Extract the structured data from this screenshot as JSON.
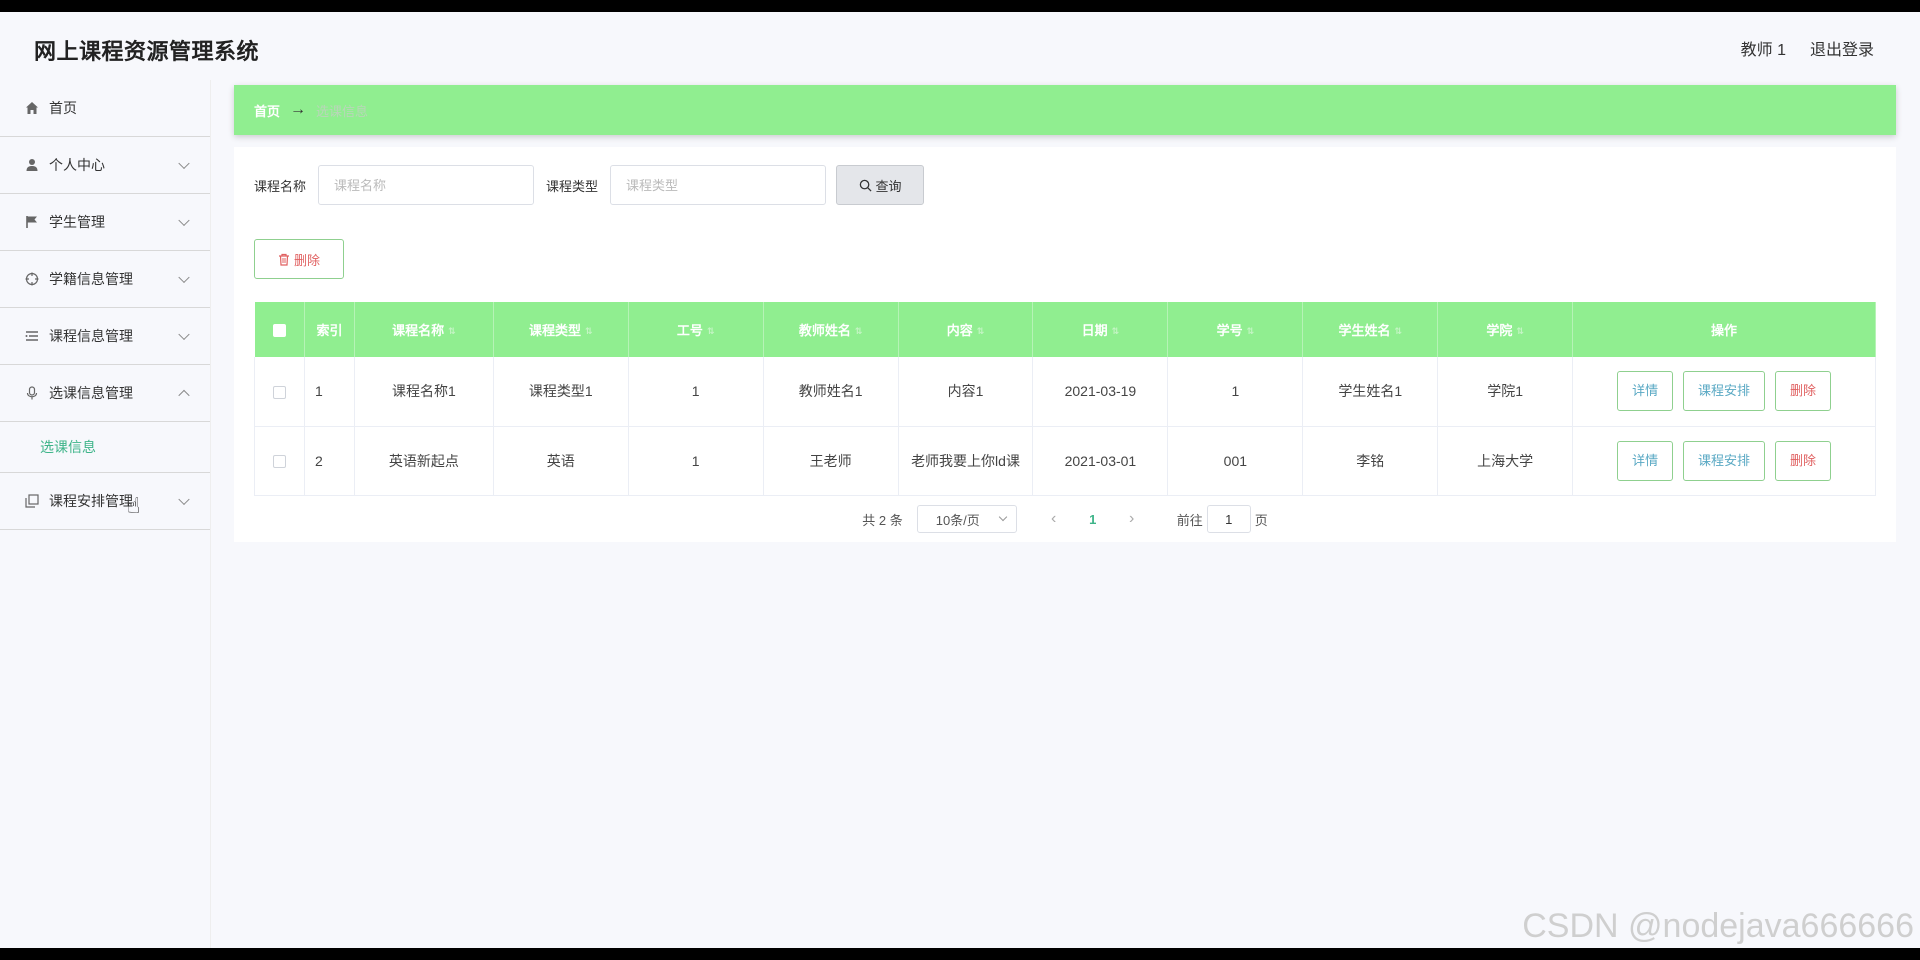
{
  "header": {
    "title": "网上课程资源管理系统",
    "user": "教师 1",
    "logout": "退出登录"
  },
  "sidebar": {
    "items": [
      {
        "label": "首页",
        "icon": "home-icon"
      },
      {
        "label": "个人中心",
        "icon": "user-icon"
      },
      {
        "label": "学生管理",
        "icon": "flag-icon"
      },
      {
        "label": "学籍信息管理",
        "icon": "target-icon"
      },
      {
        "label": "课程信息管理",
        "icon": "list-icon"
      },
      {
        "label": "选课信息管理",
        "icon": "microphone-icon"
      },
      {
        "label": "课程安排管理",
        "icon": "copy-icon"
      }
    ],
    "sub_item": "选课信息"
  },
  "breadcrumb": {
    "home": "首页",
    "arrow": "→",
    "current": "选课信息"
  },
  "search": {
    "name_label": "课程名称",
    "name_placeholder": "课程名称",
    "type_label": "课程类型",
    "type_placeholder": "课程类型",
    "query_label": "查询"
  },
  "toolbar": {
    "delete_label": "删除"
  },
  "table": {
    "columns": [
      "索引",
      "课程名称",
      "课程类型",
      "工号",
      "教师姓名",
      "内容",
      "日期",
      "学号",
      "学生姓名",
      "学院",
      "操作"
    ],
    "rows": [
      {
        "index": "1",
        "course_name": "课程名称1",
        "course_type": "课程类型1",
        "work_no": "1",
        "teacher": "教师姓名1",
        "content": "内容1",
        "date": "2021-03-19",
        "student_no": "1",
        "student": "学生姓名1",
        "college": "学院1"
      },
      {
        "index": "2",
        "course_name": "英语新起点",
        "course_type": "英语",
        "work_no": "1",
        "teacher": "王老师",
        "content": "老师我要上你ld课",
        "date": "2021-03-01",
        "student_no": "001",
        "student": "李铭",
        "college": "上海大学"
      }
    ],
    "actions": {
      "detail": "详情",
      "arrange": "课程安排",
      "delete": "删除"
    }
  },
  "pagination": {
    "total": "共 2 条",
    "page_size": "10条/页",
    "current_page": "1",
    "goto_prefix": "前往",
    "goto_value": "1",
    "goto_suffix": "页"
  },
  "watermark": "CSDN @nodejava666666",
  "colors": {
    "accent": "#90ee90",
    "link": "#3eb489",
    "danger": "#e06060"
  }
}
